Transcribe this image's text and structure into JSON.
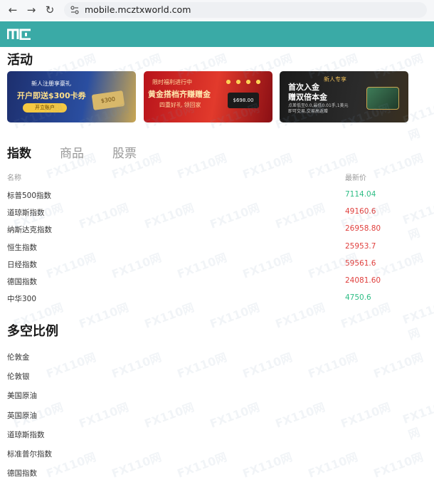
{
  "browser": {
    "url": "mobile.mcztxworld.com",
    "back_icon": "arrow-left",
    "forward_icon": "arrow-right",
    "reload_icon": "reload"
  },
  "header": {
    "logo": "mc-logo",
    "color": "#3aaaa6"
  },
  "activity": {
    "title": "活动",
    "banners": [
      {
        "line1": "新人注册享豪礼",
        "line2": "开户即送$300卡券",
        "button": "开立账户",
        "extra": "$300"
      },
      {
        "line1": "限时福利进行中",
        "line2": "黄金搭档齐赚赠金",
        "line3": "四重好礼 领回家",
        "extra": "$698.00"
      },
      {
        "line1": "新人专享",
        "line2": "首次入金",
        "line3": "赠双倍本金",
        "line4": "点差低至0.0,最低0.01手,1美元即可交易,交易高返赠"
      }
    ]
  },
  "tabs": [
    {
      "label": "指数",
      "active": true
    },
    {
      "label": "商品",
      "active": false
    },
    {
      "label": "股票",
      "active": false
    }
  ],
  "table": {
    "col_name": "名称",
    "col_price": "最新价",
    "rows": [
      {
        "name": "标普500指数",
        "price": "7114.04",
        "color": "#2ebd85"
      },
      {
        "name": "道琼斯指数",
        "price": "49160.6",
        "color": "#e0403e"
      },
      {
        "name": "纳斯达克指数",
        "price": "26958.80",
        "color": "#e0403e"
      },
      {
        "name": "恒生指数",
        "price": "25953.7",
        "color": "#e0403e"
      },
      {
        "name": "日经指数",
        "price": "59561.6",
        "color": "#e0403e"
      },
      {
        "name": "德国指数",
        "price": "24081.60",
        "color": "#e0403e"
      },
      {
        "name": "中华300",
        "price": "4750.6",
        "color": "#2ebd85"
      }
    ]
  },
  "long_short": {
    "title": "多空比例",
    "items": [
      "伦敦金",
      "伦敦银",
      "美国原油",
      "英国原油",
      "道琼斯指数",
      "标准普尔指数",
      "德国指数"
    ]
  },
  "watermark": "FX110网"
}
